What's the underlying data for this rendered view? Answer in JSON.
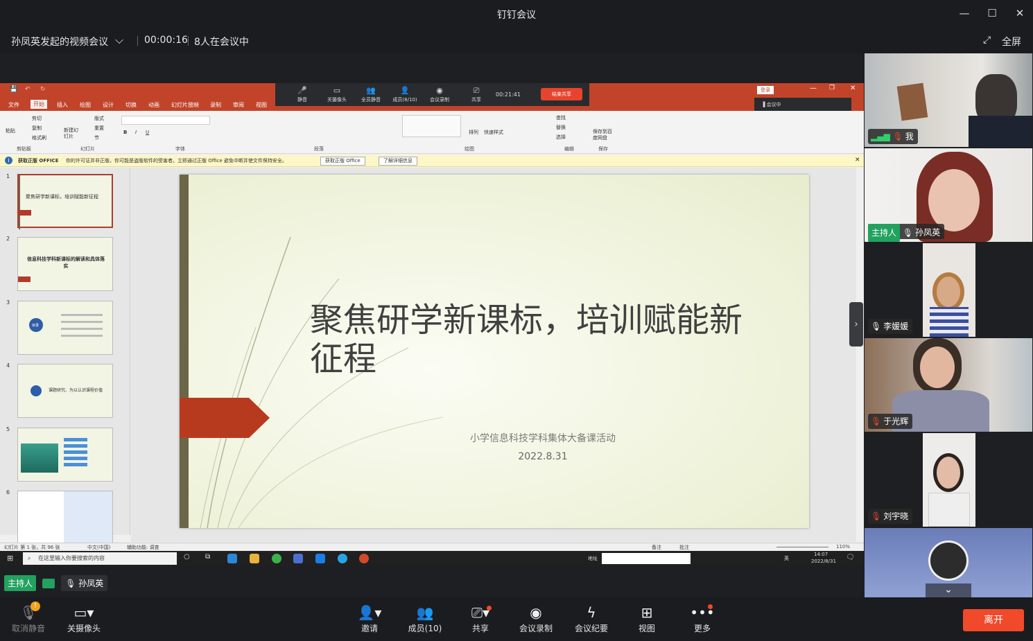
{
  "window": {
    "title": "钉钉会议"
  },
  "meeting": {
    "title": "孙凤英发起的视频会议",
    "duration": "00:00:16",
    "participants": "8人在会议中",
    "fullscreen": "全屏"
  },
  "ppt": {
    "tabs": [
      "文件",
      "开始",
      "插入",
      "绘图",
      "设计",
      "切换",
      "动画",
      "幻灯片放映",
      "录制",
      "审阅",
      "视图"
    ],
    "active_tab": "开始",
    "login": "登录",
    "meetbar": {
      "mute": "静音",
      "camera": "关摄像头",
      "mute_all": "全员静音",
      "members": "成员(8/10)",
      "record": "会议录制",
      "share": "共享",
      "timer": "00:21:41",
      "end_share": "结束共享",
      "status": "会议中"
    },
    "ribbon_groups": [
      "剪贴板",
      "幻灯片",
      "字体",
      "段落",
      "绘图",
      "编辑",
      "保存"
    ],
    "ribbon_items": {
      "paste": "粘贴",
      "cut": "剪切",
      "copy": "复制",
      "format_painter": "格式刷",
      "new_slide": "新建幻灯片",
      "layout": "版式",
      "reset": "重置",
      "section": "节",
      "find": "查找",
      "replace": "替换",
      "select": "选择",
      "arrange": "排列",
      "quick_styles": "快速样式",
      "save_baidu": "保存到百度网盘"
    },
    "warning": {
      "label": "获取正版 OFFICE",
      "text": "你的许可证并非正版，你可能是盗版软件的受害者。立即通过正版 Office 避免中断并使文件保持安全。",
      "btn1": "获取正版 Office",
      "btn2": "了解详细信息"
    },
    "thumbs": [
      {
        "num": "1",
        "caption": "聚焦研学新课标，培训赋能新征程"
      },
      {
        "num": "2",
        "caption": "信息科技学科新课标的解读和具体落实"
      },
      {
        "num": "3",
        "caption": "目录"
      },
      {
        "num": "4",
        "caption": "课题研究、为以认识课程价值"
      },
      {
        "num": "5",
        "caption": ""
      },
      {
        "num": "6",
        "caption": ""
      }
    ],
    "slide": {
      "title": "聚焦研学新课标，培训赋能新征程",
      "subtitle": "小学信息科技学科集体大备课活动",
      "date": "2022.8.31"
    },
    "status": {
      "slide_info": "幻灯片 第 1 张，共 96 张",
      "lang": "中文(中国)",
      "accessibility": "辅助功能: 调查",
      "notes": "备注",
      "comments": "批注",
      "zoom": "110%"
    },
    "taskbar": {
      "search": "在这里输入你要搜索的内容",
      "address": "地址",
      "time": "14:07",
      "date": "2022/8/31",
      "ime": "英"
    }
  },
  "speaker": {
    "role": "主持人",
    "name": "孙凤英"
  },
  "participants": [
    {
      "name": "我",
      "muted": true
    },
    {
      "name": "孙凤英",
      "host": "主持人",
      "muted": false
    },
    {
      "name": "李媛媛",
      "muted": false
    },
    {
      "name": "于光辉",
      "muted": true
    },
    {
      "name": "刘宇晓",
      "muted": true
    },
    {
      "name": "",
      "muted": false
    }
  ],
  "toolbar": {
    "unmute": "取消静音",
    "camera_off": "关摄像头",
    "invite": "邀请",
    "members": "成员(10)",
    "share": "共享",
    "record": "会议录制",
    "minutes": "会议纪要",
    "view": "视图",
    "more": "更多",
    "leave": "离开"
  },
  "colors": {
    "ppt_red": "#c1442a",
    "host_green": "#23a15f",
    "leave_red": "#f04a2b",
    "bg": "#1e1f22"
  }
}
